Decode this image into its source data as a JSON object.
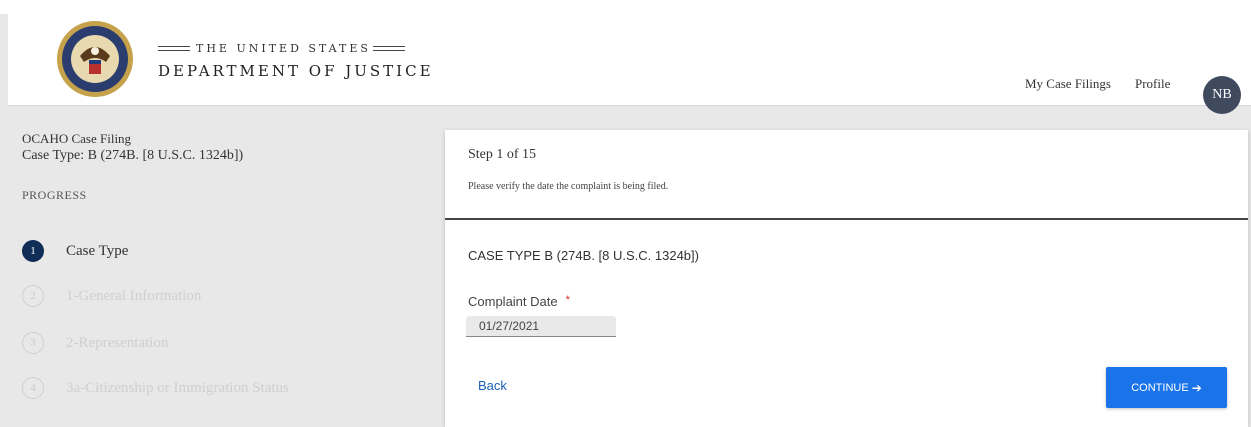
{
  "header": {
    "brand_small": "THE UNITED STATES",
    "brand_big": "DEPARTMENT OF JUSTICE",
    "nav": [
      {
        "label": "My Case Filings"
      },
      {
        "label": "Profile"
      }
    ],
    "avatar_initials": "NB"
  },
  "sidebar": {
    "title": "OCAHO Case Filing",
    "case_type": "Case Type: B (274B. [8 U.S.C. 1324b])",
    "progress_label": "PROGRESS",
    "steps": [
      {
        "num": "1",
        "label": "Case Type",
        "state": "active"
      },
      {
        "num": "2",
        "label": "1-General Information",
        "state": "inactive"
      },
      {
        "num": "3",
        "label": "2-Representation",
        "state": "inactive"
      },
      {
        "num": "4",
        "label": "3a-Citizenship or Immigration Status",
        "state": "inactive"
      }
    ]
  },
  "card": {
    "step_title": "Step 1 of 15",
    "instruction": "Please verify the date the complaint is being filed.",
    "section_title": "CASE TYPE B (274B. [8 U.S.C. 1324b])",
    "complaint_date_label": "Complaint Date",
    "required_marker": "*",
    "complaint_date_value": "01/27/2021",
    "back_label": "Back",
    "continue_label": "CONTINUE",
    "continue_arrow": "➔"
  },
  "colors": {
    "primary_button": "#1a73e8",
    "active_step": "#0f2d57",
    "avatar_bg": "#3f4a5e",
    "link": "#1a63b8",
    "required": "#dd2222"
  }
}
